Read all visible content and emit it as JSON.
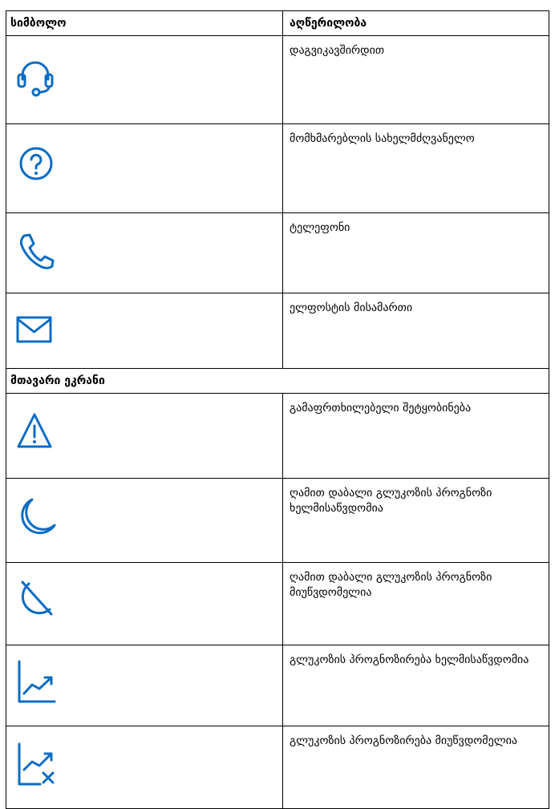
{
  "header": {
    "symbol": "სიმბოლო",
    "description": "აღწერილობა"
  },
  "section_main_screen": "მთავარი ეკრანი",
  "rows_top": [
    {
      "icon": "headset-icon",
      "label": "დაგვიკავშირდით"
    },
    {
      "icon": "help-question-icon",
      "label": "მომხმარებლის სახელმძღვანელო"
    },
    {
      "icon": "phone-icon",
      "label": "ტელეფონი"
    },
    {
      "icon": "envelope-icon",
      "label": "ელფოსტის მისამართი"
    }
  ],
  "rows_main": [
    {
      "icon": "warning-triangle-icon",
      "label": "გამაფრთხილებელი შეტყობინება"
    },
    {
      "icon": "moon-icon",
      "label": "ღამით დაბალი გლუკოზის პროგნოზი ხელმისაწვდომია"
    },
    {
      "icon": "moon-off-icon",
      "label": "ღამით დაბალი გლუკოზის პროგნოზი მიუწვდომელია"
    },
    {
      "icon": "trend-chart-icon",
      "label": "გლუკოზის პროგნოზირება ხელმისაწვდომია"
    },
    {
      "icon": "trend-chart-off-icon",
      "label": "გლუკოზის პროგნოზირება მიუწვდომელია"
    }
  ],
  "colors": {
    "icon": "#0a6cc4",
    "border": "#000000"
  }
}
